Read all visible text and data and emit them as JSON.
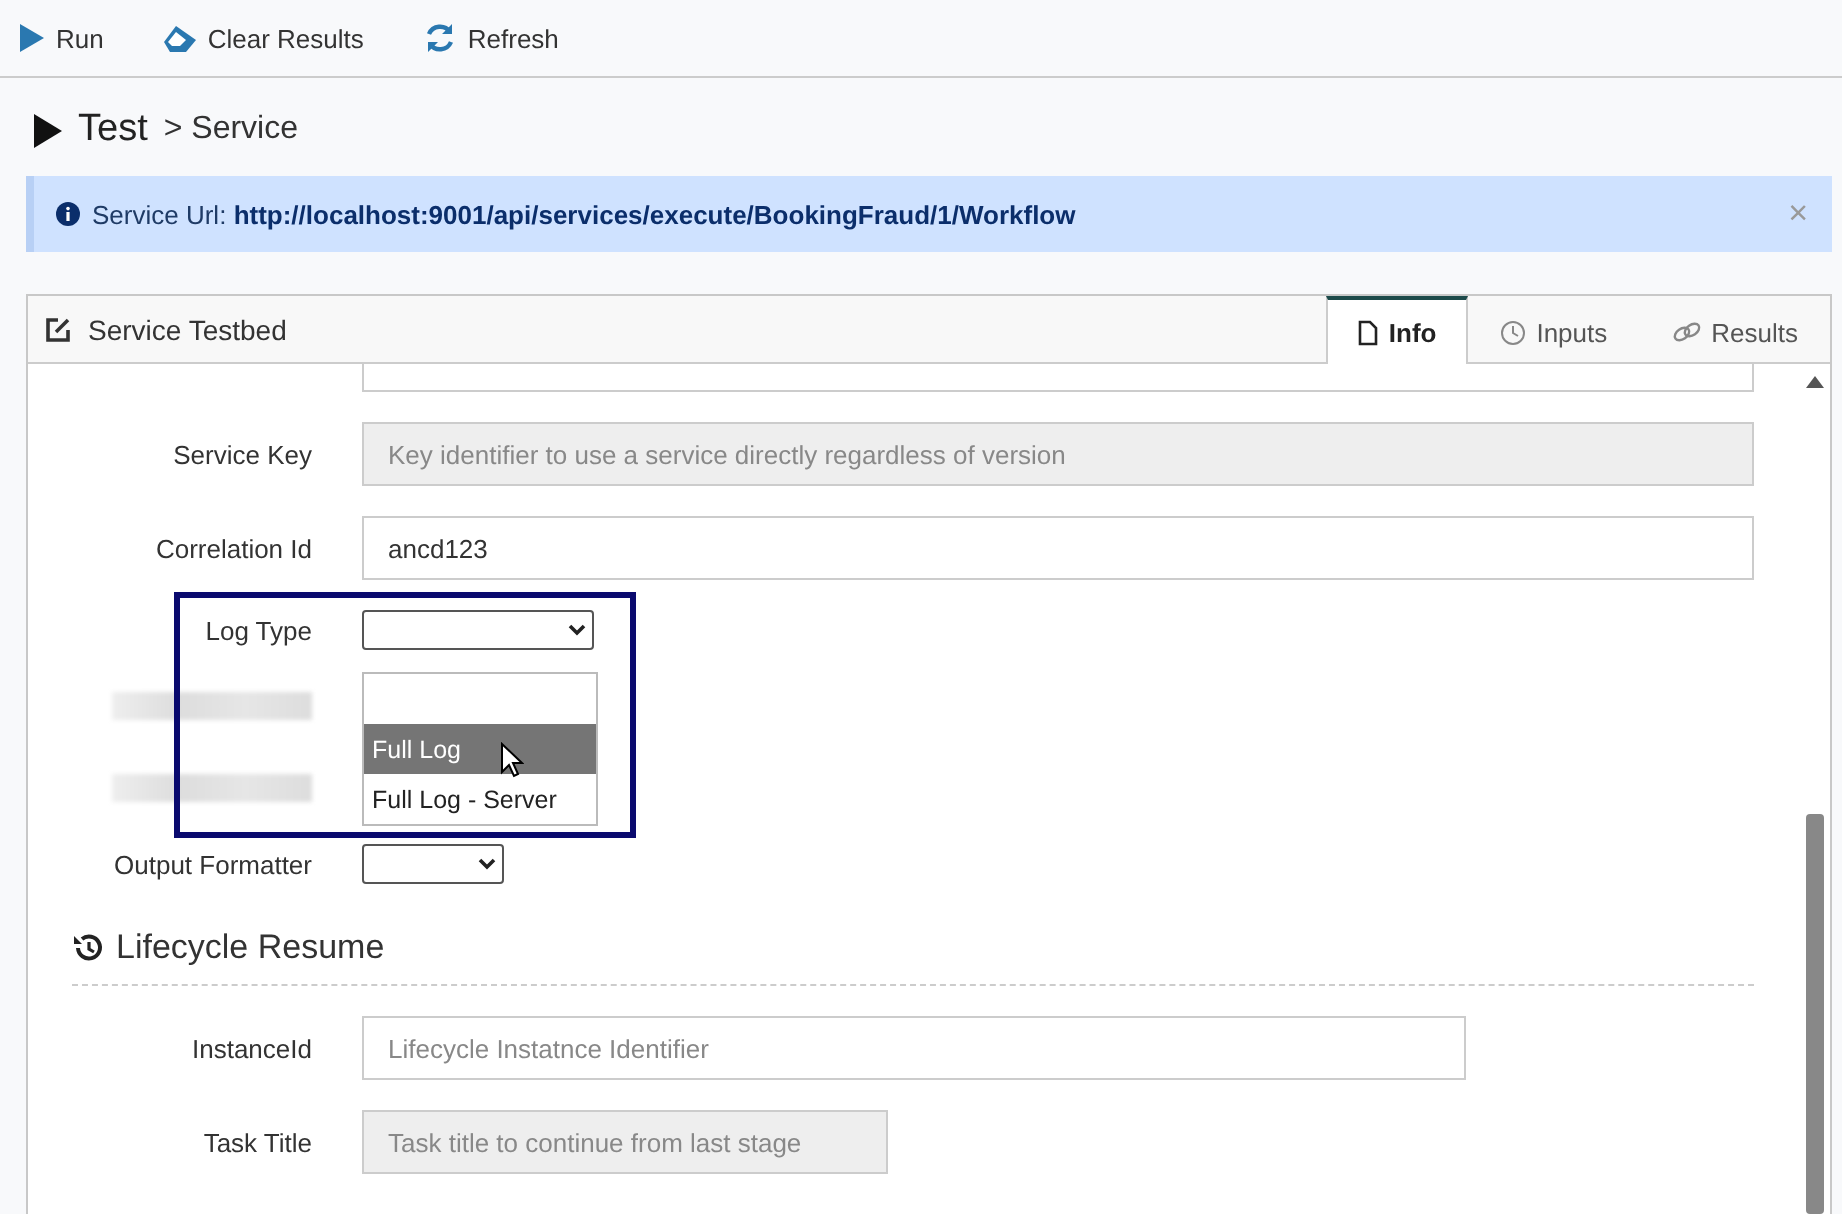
{
  "toolbar": [
    {
      "kind": "run",
      "label": "Run"
    },
    {
      "kind": "clear",
      "label": "Clear Results"
    },
    {
      "kind": "refresh",
      "label": "Refresh"
    }
  ],
  "breadcrumb": {
    "root": "Test",
    "separator": ">",
    "current": "Service"
  },
  "alert": {
    "label": "Service Url:",
    "url": "http://localhost:9001/api/services/execute/BookingFraud/1/Workflow",
    "close": "×"
  },
  "card": {
    "title": "Service Testbed",
    "tabs": [
      {
        "kind": "file",
        "label": "Info",
        "selected": true
      },
      {
        "kind": "clock",
        "label": "Inputs",
        "selected": false
      },
      {
        "kind": "link",
        "label": "Results",
        "selected": false
      }
    ]
  },
  "fields": [
    {
      "kind": "cut"
    },
    {
      "kind": "input",
      "label": "Service Key",
      "placeholder": "Key identifier to use a service directly regardless of version",
      "disabled": true
    },
    {
      "kind": "input",
      "label": "Correlation Id",
      "value": "ancd123",
      "disabled": false
    },
    {
      "kind": "select",
      "label": "Log Type",
      "open": true,
      "highlighted": true,
      "options": [
        {
          "label": "Full Log",
          "selected": true
        },
        {
          "label": "Full Log - Server",
          "selected": false
        }
      ]
    },
    {
      "kind": "redacted"
    },
    {
      "kind": "redacted"
    },
    {
      "kind": "select",
      "label": "Output Formatter",
      "open": false,
      "highlighted": false
    }
  ],
  "section": {
    "title": "Lifecycle Resume",
    "fields": [
      {
        "kind": "input",
        "label": "InstanceId",
        "placeholder": "Lifecycle Instatnce Identifier",
        "disabled": false
      },
      {
        "kind": "input",
        "label": "Task Title",
        "placeholder": "Task title to continue from last stage",
        "disabled": true
      }
    ]
  }
}
